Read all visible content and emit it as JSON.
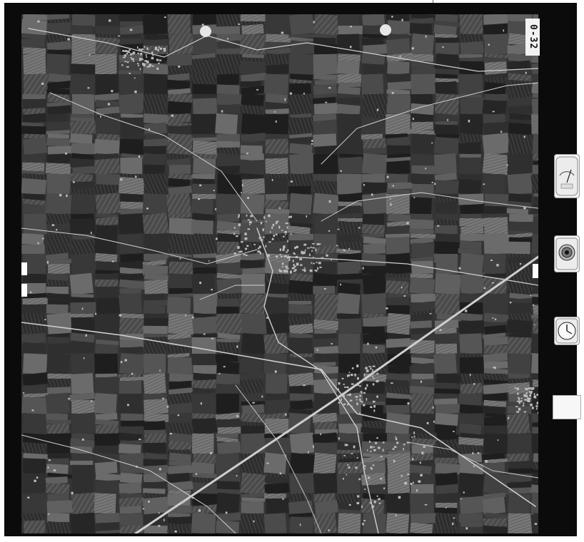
{
  "photo": {
    "frame_number": "0-32",
    "datacard_lines": [
      "",
      "",
      "",
      ""
    ]
  },
  "colors": {
    "frame": "#0b0b0b",
    "paper": "#ffffff",
    "ground": "#3a3a3a",
    "road": "#cfcfcf"
  },
  "icons": {
    "gauge": "altimeter-icon",
    "counter": "level-bubble-icon",
    "clock": "clock-icon"
  }
}
